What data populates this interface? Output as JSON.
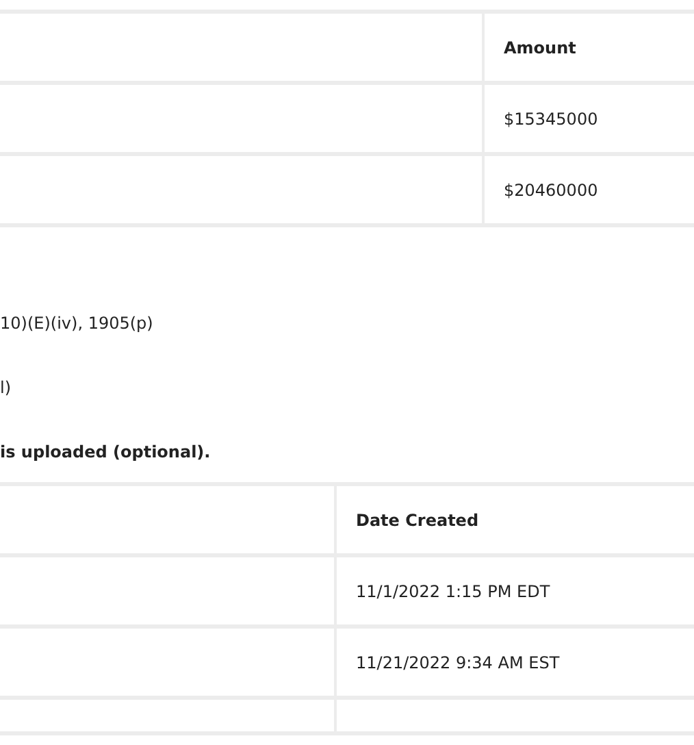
{
  "amount_table": {
    "header": "Amount",
    "rows": [
      "$15345000",
      "$20460000"
    ]
  },
  "lines": [
    {
      "text": "10)(E)(iv), 1905(p)",
      "bold": false
    },
    {
      "text": "l)",
      "bold": false
    },
    {
      "text": "is uploaded (optional).",
      "bold": true
    }
  ],
  "documents_table": {
    "header": "Date Created",
    "rows": [
      "11/1/2022 1:15 PM EDT",
      "11/21/2022 9:34 AM EST"
    ]
  }
}
